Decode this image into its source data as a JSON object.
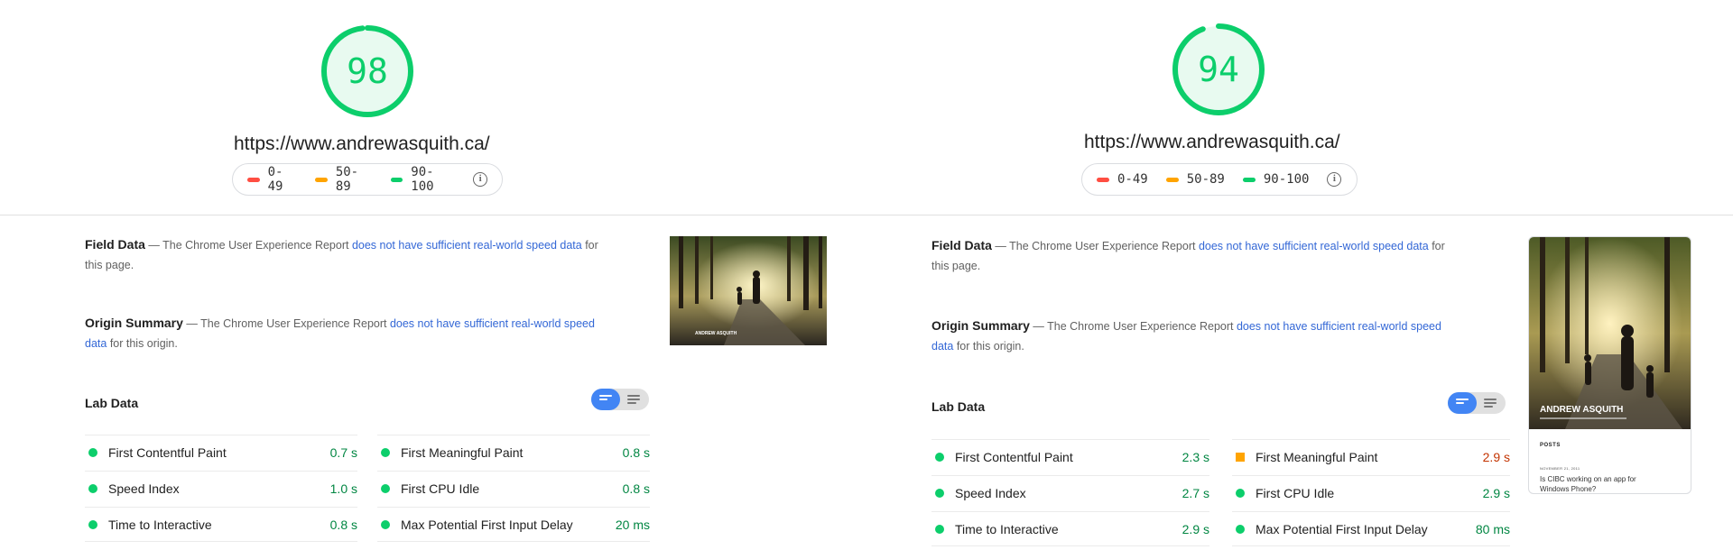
{
  "legend": {
    "fail": "0-49",
    "average": "50-89",
    "pass": "90-100",
    "info_icon": "info-icon",
    "colors": {
      "fail": "#ff4e42",
      "average": "#ffa400",
      "pass": "#0cce6b"
    }
  },
  "reports": [
    {
      "score": "98",
      "score_fraction": 0.98,
      "url": "https://www.andrewasquith.ca/",
      "field": {
        "title": "Field Data",
        "pre": " — The Chrome User Experience Report ",
        "link": "does not have sufficient real-world speed data",
        "post": " for this page."
      },
      "origin": {
        "title": "Origin Summary",
        "pre": " — The Chrome User Experience Report ",
        "link": "does not have sufficient real-world speed data",
        "post": " for this origin."
      },
      "lab_title": "Lab Data",
      "metrics_left": [
        {
          "label": "First Contentful Paint",
          "value": "0.7 s",
          "status": "pass"
        },
        {
          "label": "Speed Index",
          "value": "1.0 s",
          "status": "pass"
        },
        {
          "label": "Time to Interactive",
          "value": "0.8 s",
          "status": "pass"
        }
      ],
      "metrics_right": [
        {
          "label": "First Meaningful Paint",
          "value": "0.8 s",
          "status": "pass"
        },
        {
          "label": "First CPU Idle",
          "value": "0.8 s",
          "status": "pass"
        },
        {
          "label": "Max Potential First Input Delay",
          "value": "20 ms",
          "status": "pass"
        }
      ],
      "screenshot": {
        "heading": "ANDREW ASQUITH"
      }
    },
    {
      "score": "94",
      "score_fraction": 0.94,
      "url": "https://www.andrewasquith.ca/",
      "field": {
        "title": "Field Data",
        "pre": " — The Chrome User Experience Report ",
        "link": "does not have sufficient real-world speed data",
        "post": " for this page."
      },
      "origin": {
        "title": "Origin Summary",
        "pre": " — The Chrome User Experience Report ",
        "link": "does not have sufficient real-world speed data",
        "post": " for this origin."
      },
      "lab_title": "Lab Data",
      "metrics_left": [
        {
          "label": "First Contentful Paint",
          "value": "2.3 s",
          "status": "pass"
        },
        {
          "label": "Speed Index",
          "value": "2.7 s",
          "status": "pass"
        },
        {
          "label": "Time to Interactive",
          "value": "2.9 s",
          "status": "pass"
        }
      ],
      "metrics_right": [
        {
          "label": "First Meaningful Paint",
          "value": "2.9 s",
          "status": "average"
        },
        {
          "label": "First CPU Idle",
          "value": "2.9 s",
          "status": "pass"
        },
        {
          "label": "Max Potential First Input Delay",
          "value": "80 ms",
          "status": "pass"
        }
      ],
      "screenshot": {
        "heading": "ANDREW ASQUITH",
        "section": "POSTS",
        "date": "NOVEMBER 21, 2011",
        "post_title": "Is CIBC working on an app for Windows Phone?"
      }
    }
  ]
}
